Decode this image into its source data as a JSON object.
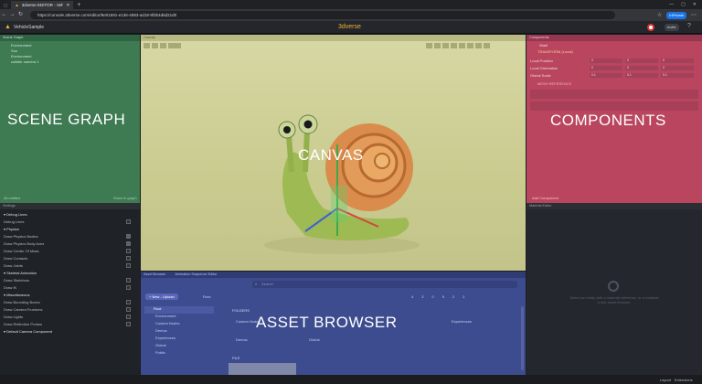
{
  "browser": {
    "tab_title": "3dverse EDITOR - VehicleSample",
    "new_tab": "+",
    "url": "https://console.3dverse.com/editor/8e01591-e136-4883-ad18-9f3b4d6d21d0",
    "profile_label": "InPrivate"
  },
  "app": {
    "project_name": "VehicleSample",
    "brand": "3dverse",
    "invite_label": "Invite",
    "brand_color": "#f2b134"
  },
  "scene_graph": {
    "title": "Scene Graph",
    "items": [
      "Environment",
      "Sun",
      "Environment",
      "collider camera 1"
    ],
    "footer_left": "46 entities",
    "footer_right": "Show in graph",
    "overlay_label": "SCENE GRAPH",
    "color": "#3e7a52"
  },
  "settings": {
    "title": "Settings",
    "sections": [
      {
        "header": "Debug Lines",
        "rows": [
          {
            "label": "Debug Lines",
            "checked": false
          }
        ]
      },
      {
        "header": "Physics",
        "rows": [
          {
            "label": "Draw Physics Bodies",
            "checked": true
          },
          {
            "label": "Draw Physics Body Axes",
            "checked": true
          },
          {
            "label": "Draw Center Of Mass",
            "checked": false
          },
          {
            "label": "Draw Contacts",
            "checked": false
          },
          {
            "label": "Draw Joints",
            "checked": false
          }
        ]
      },
      {
        "header": "Skeletal Animation",
        "rows": [
          {
            "label": "Draw Skeletons",
            "checked": false
          },
          {
            "label": "Draw IK",
            "checked": false
          }
        ]
      },
      {
        "header": "Miscellaneous",
        "rows": [
          {
            "label": "Draw Bounding Boxes",
            "checked": false
          },
          {
            "label": "Draw Camera Frustums",
            "checked": false
          },
          {
            "label": "Draw Lights",
            "checked": false
          },
          {
            "label": "Draw Reflection Probes",
            "checked": false
          }
        ]
      },
      {
        "header": "Default Camera Component",
        "rows": []
      }
    ]
  },
  "canvas": {
    "title": "Canvas",
    "overlay_label": "CANVAS",
    "color": "#d6d79f"
  },
  "components": {
    "title": "Components",
    "entity_name": "Shell",
    "section_transform": "TRANSFORM (Local)",
    "transform_rows": [
      {
        "label": "Local Position",
        "values": [
          "0",
          "0",
          "0"
        ]
      },
      {
        "label": "Local Orientation",
        "values": [
          "0",
          "0",
          "0"
        ]
      },
      {
        "label": "Global Scale",
        "values": [
          "0.1",
          "0.1",
          "0.1"
        ]
      }
    ],
    "section_mesh": "MESH REFERENCE",
    "overlay_label": "COMPONENTS",
    "add_component": "Add Component",
    "color": "#b9455f"
  },
  "material_editor": {
    "title": "Material Editor",
    "empty_text": "Select an entity with a material reference, or a material in the asset browser."
  },
  "asset_browser": {
    "title": "Asset Browser",
    "tab2": "Animation Sequence Editor",
    "search_placeholder": "Search",
    "new_upload": "+ New - Upload",
    "breadcrumb_root": "Root",
    "tree": [
      "Root",
      "Environment",
      "Custom Nodes",
      "Demos",
      "Experiences",
      "Global",
      "Public"
    ],
    "folders_header": "FOLDERS",
    "folders": [
      "Custom Nodes",
      "Experiences",
      "Demos",
      "Global"
    ],
    "files_header": "FILE",
    "counts": [
      "4",
      "3",
      "0",
      "5",
      "2",
      "2"
    ],
    "overlay_label": "ASSET BROWSER",
    "color": "#3d4c8f"
  },
  "statusbar": {
    "left": "",
    "right_items": [
      "Layout",
      "Extensions"
    ]
  }
}
